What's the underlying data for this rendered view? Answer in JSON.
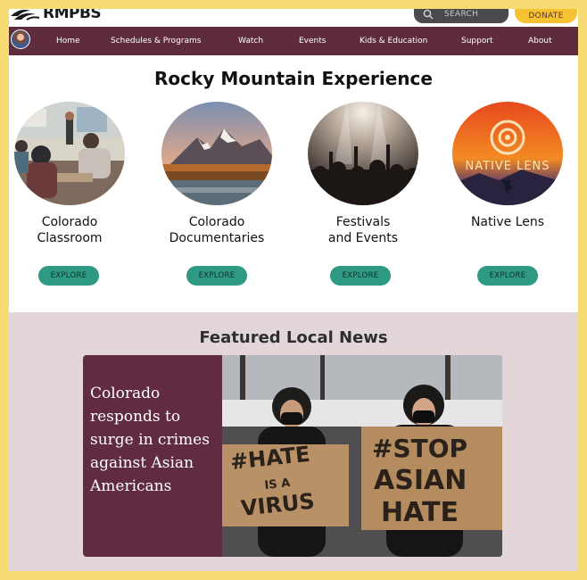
{
  "header": {
    "logo_text": "RMPBS",
    "search_placeholder": "SEARCH",
    "donate_label": "DONATE"
  },
  "nav": {
    "items": [
      "Home",
      "Schedules & Programs",
      "Watch",
      "Events",
      "Kids & Education",
      "Support",
      "About"
    ]
  },
  "experience": {
    "title": "Rocky Mountain Experience",
    "cards": [
      {
        "title": "Colorado\nClassroom",
        "button": "EXPLORE",
        "image": "classroom-photo"
      },
      {
        "title": "Colorado\nDocumentaries",
        "button": "EXPLORE",
        "image": "mountain-lake-photo"
      },
      {
        "title": "Festivals\nand Events",
        "button": "EXPLORE",
        "image": "concert-crowd-photo"
      },
      {
        "title": "Native Lens",
        "button": "EXPLORE",
        "image": "native-lens-logo",
        "image_caption": "NATIVE LENS"
      }
    ]
  },
  "news": {
    "section_title": "Featured Local News",
    "headline": "Colorado responds to surge in crimes against Asian Americans",
    "sign_left": [
      "#HATE",
      "IS A",
      "VIRUS"
    ],
    "sign_right": [
      "#STOP",
      "ASIAN",
      "HATE"
    ]
  },
  "colors": {
    "frame": "#f7dc74",
    "nav_bg": "#5f2c3e",
    "accent_teal": "#2f9a83",
    "donate": "#f7c232",
    "news_bg": "#e3d6d9",
    "news_card": "#612c41"
  }
}
